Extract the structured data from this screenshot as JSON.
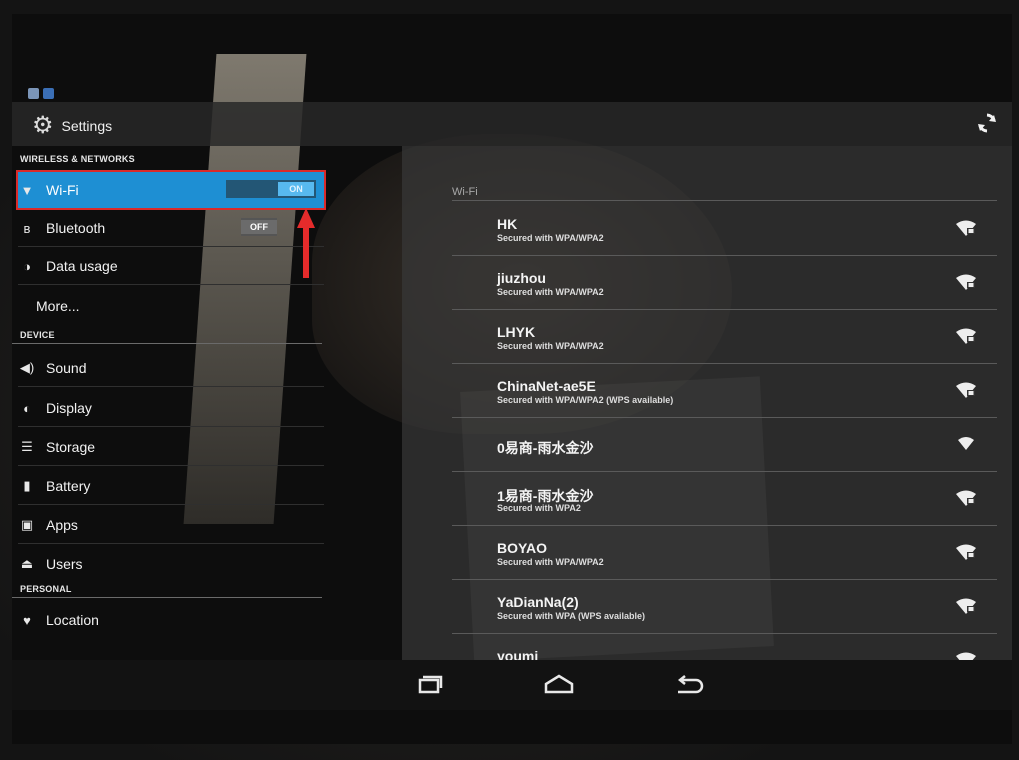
{
  "app": {
    "title": "Settings"
  },
  "sidebar": {
    "sections": [
      {
        "header": "WIRELESS & NETWORKS"
      },
      {
        "header": "DEVICE"
      },
      {
        "header": "PERSONAL"
      }
    ],
    "items": [
      {
        "label": "Wi-Fi",
        "icon": "wifi-icon",
        "toggle": "ON",
        "selected": true
      },
      {
        "label": "Bluetooth",
        "icon": "bluetooth-icon",
        "toggle": "OFF"
      },
      {
        "label": "Data usage",
        "icon": "data-usage-icon"
      },
      {
        "label": "More..."
      },
      {
        "label": "Sound",
        "icon": "speaker-icon"
      },
      {
        "label": "Display",
        "icon": "display-icon"
      },
      {
        "label": "Storage",
        "icon": "storage-icon"
      },
      {
        "label": "Battery",
        "icon": "battery-icon"
      },
      {
        "label": "Apps",
        "icon": "apps-icon"
      },
      {
        "label": "Users",
        "icon": "users-icon"
      },
      {
        "label": "Location",
        "icon": "location-icon"
      }
    ]
  },
  "wifi": {
    "header": "Wi-Fi",
    "networks": [
      {
        "name": "HK",
        "status": "Secured with WPA/WPA2",
        "secured": true
      },
      {
        "name": "jiuzhou",
        "status": "Secured with WPA/WPA2",
        "secured": true
      },
      {
        "name": "LHYK",
        "status": "Secured with WPA/WPA2",
        "secured": true
      },
      {
        "name": "ChinaNet-ae5E",
        "status": "Secured with WPA/WPA2 (WPS available)",
        "secured": true
      },
      {
        "name": "0易商-雨水金沙",
        "status": "",
        "secured": false
      },
      {
        "name": "1易商-雨水金沙",
        "status": "Secured with WPA2",
        "secured": true
      },
      {
        "name": "BOYAO",
        "status": "Secured with WPA/WPA2",
        "secured": true
      },
      {
        "name": "YaDianNa(2)",
        "status": "Secured with WPA (WPS available)",
        "secured": true
      },
      {
        "name": "youmi",
        "status": "",
        "secured": true
      }
    ]
  },
  "nav": {
    "buttons": [
      "recent-apps-icon",
      "home-icon",
      "back-icon"
    ]
  },
  "colors": {
    "selected": "#1e8fd3",
    "toggle_on": "#57b9ef",
    "highlight_border": "#d92a2a"
  }
}
